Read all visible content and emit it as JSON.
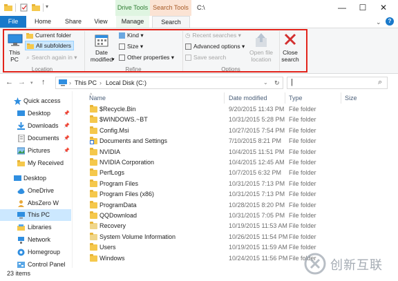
{
  "window": {
    "title": "C:\\",
    "context_header_drive": "Drive Tools",
    "context_header_search": "Search Tools",
    "minimize": "—",
    "maximize": "☐",
    "close": "✕"
  },
  "tabs": [
    {
      "label": "File"
    },
    {
      "label": "Home"
    },
    {
      "label": "Share"
    },
    {
      "label": "View"
    },
    {
      "label": "Manage"
    },
    {
      "label": "Search"
    }
  ],
  "ribbon": {
    "location": {
      "group_label": "Location",
      "this_pc": "This\nPC",
      "current_folder": "Current folder",
      "all_subfolders": "All subfolders",
      "search_again_in": "Search again in"
    },
    "refine": {
      "group_label": "Refine",
      "date_modified": "Date\nmodified",
      "kind": "Kind",
      "size": "Size",
      "other_properties": "Other properties"
    },
    "options": {
      "group_label": "Options",
      "recent_searches": "Recent searches",
      "advanced_options": "Advanced options",
      "save_search": "Save search",
      "open_file_location": "Open file\nlocation"
    },
    "close_search": "Close\nsearch"
  },
  "address": {
    "crumbs": [
      "This PC",
      "Local Disk (C:)"
    ],
    "search_value": ""
  },
  "nav": {
    "items": [
      {
        "label": "Quick access"
      },
      {
        "label": "Desktop"
      },
      {
        "label": "Downloads"
      },
      {
        "label": "Documents"
      },
      {
        "label": "Pictures"
      },
      {
        "label": "My Received"
      },
      {
        "label": "Desktop"
      },
      {
        "label": "OneDrive"
      },
      {
        "label": "AbsZero W"
      },
      {
        "label": "This PC"
      },
      {
        "label": "Libraries"
      },
      {
        "label": "Network"
      },
      {
        "label": "Homegroup"
      },
      {
        "label": "Control Panel"
      }
    ]
  },
  "list": {
    "headers": {
      "name": "Name",
      "date": "Date modified",
      "type": "Type",
      "size": "Size"
    },
    "rows": [
      {
        "name": "$Recycle.Bin",
        "date": "9/20/2015 11:43 PM",
        "type": "File folder"
      },
      {
        "name": "$WINDOWS.~BT",
        "date": "10/31/2015 5:28 PM",
        "type": "File folder"
      },
      {
        "name": "Config.Msi",
        "date": "10/27/2015 7:54 PM",
        "type": "File folder"
      },
      {
        "name": "Documents and Settings",
        "date": "7/10/2015 8:21 PM",
        "type": "File folder"
      },
      {
        "name": "NVIDIA",
        "date": "10/4/2015 11:51 PM",
        "type": "File folder"
      },
      {
        "name": "NVIDIA Corporation",
        "date": "10/4/2015 12:45 AM",
        "type": "File folder"
      },
      {
        "name": "PerfLogs",
        "date": "10/7/2015 6:32 PM",
        "type": "File folder"
      },
      {
        "name": "Program Files",
        "date": "10/31/2015 7:13 PM",
        "type": "File folder"
      },
      {
        "name": "Program Files (x86)",
        "date": "10/31/2015 7:13 PM",
        "type": "File folder"
      },
      {
        "name": "ProgramData",
        "date": "10/28/2015 8:20 PM",
        "type": "File folder"
      },
      {
        "name": "QQDownload",
        "date": "10/31/2015 7:05 PM",
        "type": "File folder"
      },
      {
        "name": "Recovery",
        "date": "10/19/2015 11:53 AM",
        "type": "File folder"
      },
      {
        "name": "System Volume Information",
        "date": "10/26/2015 11:54 PM",
        "type": "File folder"
      },
      {
        "name": "Users",
        "date": "10/19/2015 11:59 AM",
        "type": "File folder"
      },
      {
        "name": "Windows",
        "date": "10/24/2015 11:56 PM",
        "type": "File folder"
      }
    ]
  },
  "status": {
    "items_count": "23 items"
  },
  "watermark": {
    "text": "创新互联"
  },
  "colors": {
    "highlight": "#e2231a",
    "accent": "#1979ca",
    "selection": "#cce8ff"
  }
}
